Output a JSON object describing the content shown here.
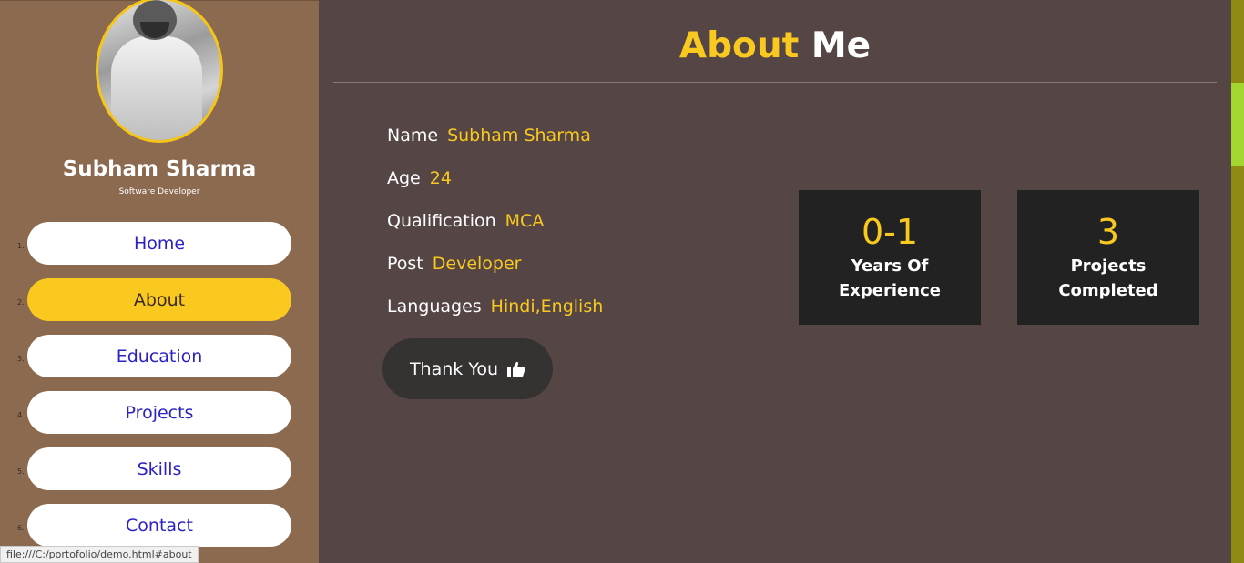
{
  "profile": {
    "name": "Subham Sharma",
    "role": "Software Developer"
  },
  "nav": [
    {
      "num": "1.",
      "label": "Home",
      "active": false
    },
    {
      "num": "2.",
      "label": "About",
      "active": true
    },
    {
      "num": "3.",
      "label": "Education",
      "active": false
    },
    {
      "num": "4.",
      "label": "Projects",
      "active": false
    },
    {
      "num": "5.",
      "label": "Skills",
      "active": false
    },
    {
      "num": "6.",
      "label": "Contact",
      "active": false
    }
  ],
  "header": {
    "title_part1": "About",
    "title_part2": "Me"
  },
  "about": {
    "name_label": "Name",
    "name_value": "Subham Sharma",
    "age_label": "Age",
    "age_value": "24",
    "qualification_label": "Qualification",
    "qualification_value": "MCA",
    "post_label": "Post",
    "post_value": "Developer",
    "languages_label": "Languages",
    "languages_value": "Hindi,English"
  },
  "thanks_button": {
    "label": "Thank You",
    "icon": "thumbs-up-icon"
  },
  "stats": [
    {
      "number": "0-1",
      "line1": "Years Of",
      "line2": "Experience"
    },
    {
      "number": "3",
      "line1": "Projects",
      "line2": "Completed"
    }
  ],
  "status_bar": {
    "url": "file:///C:/portofolio/demo.html#about"
  },
  "colors": {
    "accent": "#f9c920",
    "sidebar_bg": "#8c6a50",
    "main_bg": "#554545",
    "card_bg": "#222222",
    "nav_text": "#2b22c4"
  }
}
